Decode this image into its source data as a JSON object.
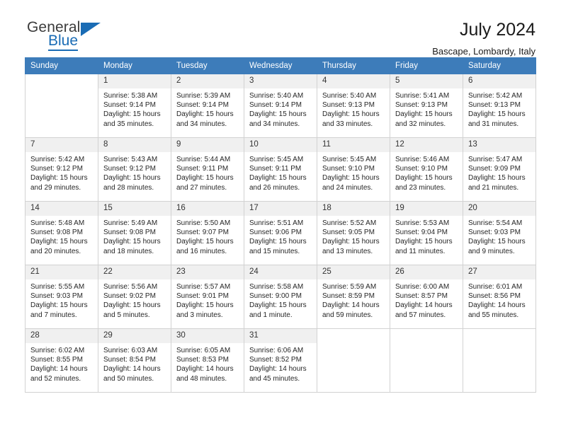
{
  "brand": {
    "word_one": "General",
    "word_two": "Blue",
    "accent_color": "#1a6cb5",
    "triangle_icon": "brand-triangle-icon"
  },
  "header": {
    "title": "July 2024",
    "subtitle": "Bascape, Lombardy, Italy"
  },
  "calendar": {
    "header_bg": "#3d7cba",
    "header_text_color": "#ffffff",
    "daynum_bg": "#f0f0f0",
    "grid_line_color": "#d2d2d2",
    "weekdays": [
      "Sunday",
      "Monday",
      "Tuesday",
      "Wednesday",
      "Thursday",
      "Friday",
      "Saturday"
    ],
    "weeks": [
      [
        {
          "day": "",
          "lines": [],
          "blank": true
        },
        {
          "day": "1",
          "lines": [
            "Sunrise: 5:38 AM",
            "Sunset: 9:14 PM",
            "Daylight: 15 hours",
            "and 35 minutes."
          ]
        },
        {
          "day": "2",
          "lines": [
            "Sunrise: 5:39 AM",
            "Sunset: 9:14 PM",
            "Daylight: 15 hours",
            "and 34 minutes."
          ]
        },
        {
          "day": "3",
          "lines": [
            "Sunrise: 5:40 AM",
            "Sunset: 9:14 PM",
            "Daylight: 15 hours",
            "and 34 minutes."
          ]
        },
        {
          "day": "4",
          "lines": [
            "Sunrise: 5:40 AM",
            "Sunset: 9:13 PM",
            "Daylight: 15 hours",
            "and 33 minutes."
          ]
        },
        {
          "day": "5",
          "lines": [
            "Sunrise: 5:41 AM",
            "Sunset: 9:13 PM",
            "Daylight: 15 hours",
            "and 32 minutes."
          ]
        },
        {
          "day": "6",
          "lines": [
            "Sunrise: 5:42 AM",
            "Sunset: 9:13 PM",
            "Daylight: 15 hours",
            "and 31 minutes."
          ]
        }
      ],
      [
        {
          "day": "7",
          "lines": [
            "Sunrise: 5:42 AM",
            "Sunset: 9:12 PM",
            "Daylight: 15 hours",
            "and 29 minutes."
          ]
        },
        {
          "day": "8",
          "lines": [
            "Sunrise: 5:43 AM",
            "Sunset: 9:12 PM",
            "Daylight: 15 hours",
            "and 28 minutes."
          ]
        },
        {
          "day": "9",
          "lines": [
            "Sunrise: 5:44 AM",
            "Sunset: 9:11 PM",
            "Daylight: 15 hours",
            "and 27 minutes."
          ]
        },
        {
          "day": "10",
          "lines": [
            "Sunrise: 5:45 AM",
            "Sunset: 9:11 PM",
            "Daylight: 15 hours",
            "and 26 minutes."
          ]
        },
        {
          "day": "11",
          "lines": [
            "Sunrise: 5:45 AM",
            "Sunset: 9:10 PM",
            "Daylight: 15 hours",
            "and 24 minutes."
          ]
        },
        {
          "day": "12",
          "lines": [
            "Sunrise: 5:46 AM",
            "Sunset: 9:10 PM",
            "Daylight: 15 hours",
            "and 23 minutes."
          ]
        },
        {
          "day": "13",
          "lines": [
            "Sunrise: 5:47 AM",
            "Sunset: 9:09 PM",
            "Daylight: 15 hours",
            "and 21 minutes."
          ]
        }
      ],
      [
        {
          "day": "14",
          "lines": [
            "Sunrise: 5:48 AM",
            "Sunset: 9:08 PM",
            "Daylight: 15 hours",
            "and 20 minutes."
          ]
        },
        {
          "day": "15",
          "lines": [
            "Sunrise: 5:49 AM",
            "Sunset: 9:08 PM",
            "Daylight: 15 hours",
            "and 18 minutes."
          ]
        },
        {
          "day": "16",
          "lines": [
            "Sunrise: 5:50 AM",
            "Sunset: 9:07 PM",
            "Daylight: 15 hours",
            "and 16 minutes."
          ]
        },
        {
          "day": "17",
          "lines": [
            "Sunrise: 5:51 AM",
            "Sunset: 9:06 PM",
            "Daylight: 15 hours",
            "and 15 minutes."
          ]
        },
        {
          "day": "18",
          "lines": [
            "Sunrise: 5:52 AM",
            "Sunset: 9:05 PM",
            "Daylight: 15 hours",
            "and 13 minutes."
          ]
        },
        {
          "day": "19",
          "lines": [
            "Sunrise: 5:53 AM",
            "Sunset: 9:04 PM",
            "Daylight: 15 hours",
            "and 11 minutes."
          ]
        },
        {
          "day": "20",
          "lines": [
            "Sunrise: 5:54 AM",
            "Sunset: 9:03 PM",
            "Daylight: 15 hours",
            "and 9 minutes."
          ]
        }
      ],
      [
        {
          "day": "21",
          "lines": [
            "Sunrise: 5:55 AM",
            "Sunset: 9:03 PM",
            "Daylight: 15 hours",
            "and 7 minutes."
          ]
        },
        {
          "day": "22",
          "lines": [
            "Sunrise: 5:56 AM",
            "Sunset: 9:02 PM",
            "Daylight: 15 hours",
            "and 5 minutes."
          ]
        },
        {
          "day": "23",
          "lines": [
            "Sunrise: 5:57 AM",
            "Sunset: 9:01 PM",
            "Daylight: 15 hours",
            "and 3 minutes."
          ]
        },
        {
          "day": "24",
          "lines": [
            "Sunrise: 5:58 AM",
            "Sunset: 9:00 PM",
            "Daylight: 15 hours",
            "and 1 minute."
          ]
        },
        {
          "day": "25",
          "lines": [
            "Sunrise: 5:59 AM",
            "Sunset: 8:59 PM",
            "Daylight: 14 hours",
            "and 59 minutes."
          ]
        },
        {
          "day": "26",
          "lines": [
            "Sunrise: 6:00 AM",
            "Sunset: 8:57 PM",
            "Daylight: 14 hours",
            "and 57 minutes."
          ]
        },
        {
          "day": "27",
          "lines": [
            "Sunrise: 6:01 AM",
            "Sunset: 8:56 PM",
            "Daylight: 14 hours",
            "and 55 minutes."
          ]
        }
      ],
      [
        {
          "day": "28",
          "lines": [
            "Sunrise: 6:02 AM",
            "Sunset: 8:55 PM",
            "Daylight: 14 hours",
            "and 52 minutes."
          ]
        },
        {
          "day": "29",
          "lines": [
            "Sunrise: 6:03 AM",
            "Sunset: 8:54 PM",
            "Daylight: 14 hours",
            "and 50 minutes."
          ]
        },
        {
          "day": "30",
          "lines": [
            "Sunrise: 6:05 AM",
            "Sunset: 8:53 PM",
            "Daylight: 14 hours",
            "and 48 minutes."
          ]
        },
        {
          "day": "31",
          "lines": [
            "Sunrise: 6:06 AM",
            "Sunset: 8:52 PM",
            "Daylight: 14 hours",
            "and 45 minutes."
          ]
        },
        {
          "day": "",
          "lines": [],
          "blank": true
        },
        {
          "day": "",
          "lines": [],
          "blank": true
        },
        {
          "day": "",
          "lines": [],
          "blank": true
        }
      ]
    ]
  }
}
